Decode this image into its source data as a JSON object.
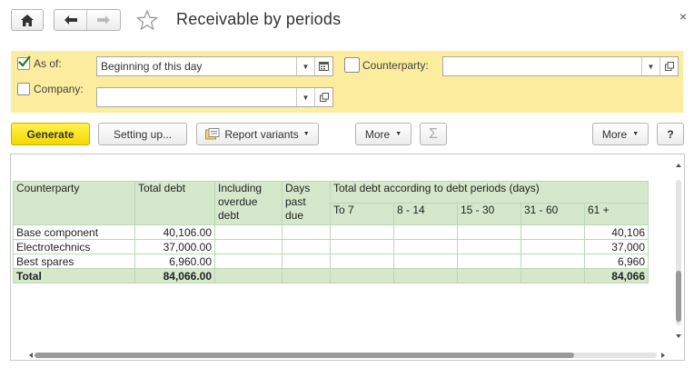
{
  "window": {
    "title": "Receivable by periods",
    "close_glyph": "×"
  },
  "params": {
    "as_of_label": "As of:",
    "as_of_checked": true,
    "as_of_value": "Beginning of this day",
    "company_label": "Company:",
    "company_checked": false,
    "company_value": "",
    "counterparty_label": "Counterparty:",
    "counterparty_checked": false,
    "counterparty_value": ""
  },
  "toolbar": {
    "generate": "Generate",
    "setting_up": "Setting up...",
    "report_variants": "Report variants",
    "more_left": "More",
    "more_right": "More",
    "sigma": "Σ",
    "help": "?"
  },
  "table": {
    "headers": {
      "counterparty": "Counterparty",
      "total_debt": "Total debt",
      "overdue": [
        "Including",
        "overdue",
        "debt"
      ],
      "days_past_due": [
        "Days",
        "past",
        "due"
      ],
      "periods_group": "Total debt according to debt periods (days)",
      "periods": [
        "To 7",
        "8 - 14",
        "15 - 30",
        "31 - 60",
        "61 +"
      ]
    },
    "rows": [
      {
        "counterparty": "Base component",
        "total": "40,106.00",
        "overdue": "",
        "days": "",
        "p1": "",
        "p2": "",
        "p3": "",
        "p4": "",
        "p5": "40,106"
      },
      {
        "counterparty": "Electrotechnics",
        "total": "37,000.00",
        "overdue": "",
        "days": "",
        "p1": "",
        "p2": "",
        "p3": "",
        "p4": "",
        "p5": "37,000"
      },
      {
        "counterparty": "Best spares",
        "total": "6,960.00",
        "overdue": "",
        "days": "",
        "p1": "",
        "p2": "",
        "p3": "",
        "p4": "",
        "p5": "6,960"
      }
    ],
    "total": {
      "label": "Total",
      "total": "84,066.00",
      "p5": "84,066"
    }
  },
  "colors": {
    "params_bg": "#fbec9e",
    "header_bg": "#d5e8cb",
    "generate_bg": "#f5d800"
  }
}
